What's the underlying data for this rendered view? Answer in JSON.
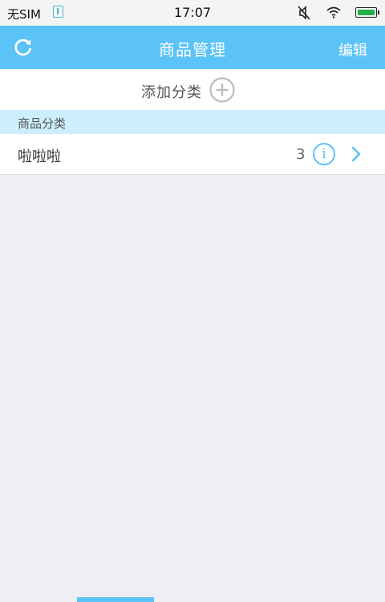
{
  "status_bar": {
    "carrier": "无SIM",
    "time": "17:07",
    "icons": [
      "usb-icon",
      "mute-icon",
      "wifi-icon",
      "battery-icon"
    ]
  },
  "nav": {
    "title": "商品管理",
    "edit_label": "编辑",
    "refresh_icon": "refresh-icon"
  },
  "add_category": {
    "label": "添加分类",
    "icon": "plus-circle-icon"
  },
  "section": {
    "title": "商品分类"
  },
  "categories": [
    {
      "name": "啦啦啦",
      "count": "3",
      "info_glyph": "i"
    }
  ],
  "colors": {
    "accent": "#5cc3f6",
    "section_bg": "#cdeefc",
    "page_bg": "#eeeef3"
  }
}
